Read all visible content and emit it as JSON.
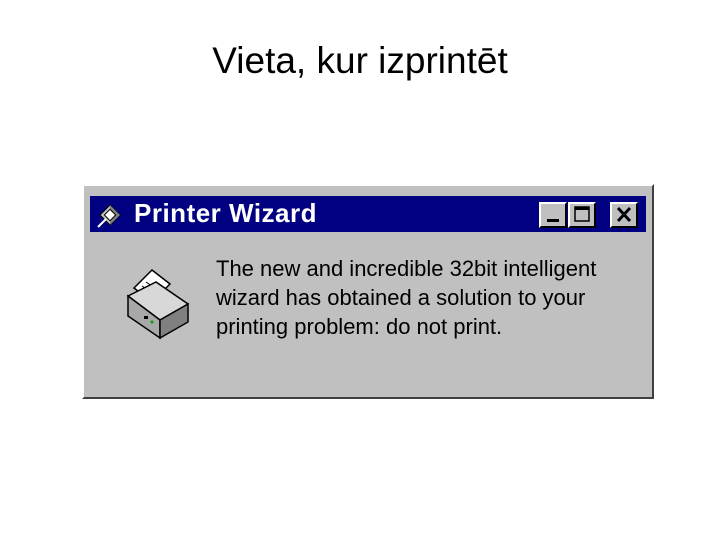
{
  "slide": {
    "title": "Vieta, kur izprintēt"
  },
  "dialog": {
    "title": "Printer Wizard",
    "title_icon": "wizard-icon",
    "controls": [
      "minimize-icon",
      "maximize-icon",
      "close-icon"
    ],
    "body_icon": "printer-icon",
    "message": "The new and incredible 32bit intelligent wizard has obtained a solution to your printing problem: do not print."
  },
  "colors": {
    "titlebar": "#000080",
    "dialog_face": "#c0c0c0",
    "title_text": "#ffffff"
  }
}
